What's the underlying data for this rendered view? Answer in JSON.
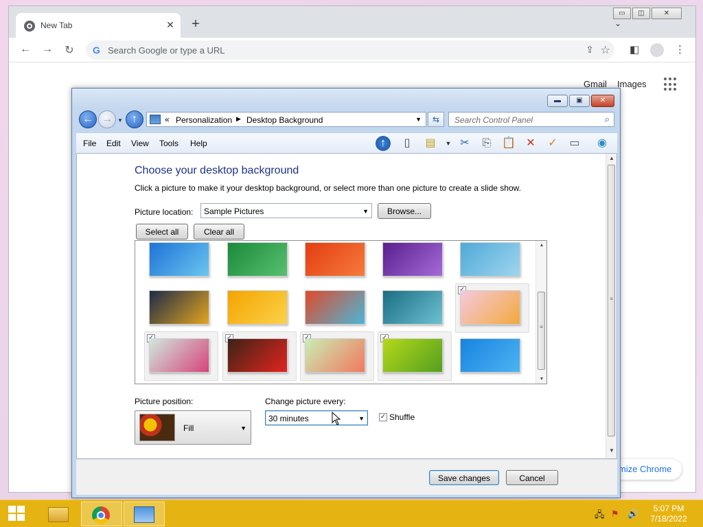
{
  "chrome": {
    "tab_title": "New Tab",
    "tab_close": "✕",
    "new_tab": "+",
    "tab_menu": "⌄",
    "omnibox_placeholder": "Search Google or type a URL",
    "google_g": "G",
    "gmail": "Gmail",
    "images": "Images",
    "customize_partial": "mize Chrome",
    "window_buttons": {
      "minimize": "▭",
      "maximize": "◫",
      "close": "✕"
    }
  },
  "control_panel": {
    "window_buttons": {
      "minimize": "▬",
      "maximize": "▣",
      "close": "✕"
    },
    "breadcrumb": {
      "prefix": "«",
      "item1": "Personalization",
      "separator": "▶",
      "item2": "Desktop Background"
    },
    "search_placeholder": "Search Control Panel",
    "menu": {
      "file": "File",
      "edit": "Edit",
      "view": "View",
      "tools": "Tools",
      "help": "Help"
    },
    "heading": "Choose your desktop background",
    "description": "Click a picture to make it your desktop background, or select more than one picture to create a slide show.",
    "picture_location_label": "Picture location:",
    "picture_location_value": "Sample Pictures",
    "browse_button": "Browse...",
    "select_all_button": "Select all",
    "clear_all_button": "Clear all",
    "thumbnails": [
      {
        "row": 1,
        "col": 1,
        "checked": false,
        "colors": [
          "#1e73d6",
          "#69c6f0"
        ]
      },
      {
        "row": 1,
        "col": 2,
        "checked": false,
        "colors": [
          "#1a8a3a",
          "#58c070"
        ]
      },
      {
        "row": 1,
        "col": 3,
        "checked": false,
        "colors": [
          "#e43d12",
          "#f57b3b"
        ]
      },
      {
        "row": 1,
        "col": 4,
        "checked": false,
        "colors": [
          "#5a1f8e",
          "#a66ad8"
        ]
      },
      {
        "row": 1,
        "col": 5,
        "checked": false,
        "colors": [
          "#4fa9d8",
          "#9fd5ee"
        ]
      },
      {
        "row": 2,
        "col": 1,
        "checked": false,
        "colors": [
          "#1d2b48",
          "#e3a51e"
        ]
      },
      {
        "row": 2,
        "col": 2,
        "checked": false,
        "colors": [
          "#f4a400",
          "#fbd24a"
        ]
      },
      {
        "row": 2,
        "col": 3,
        "checked": false,
        "colors": [
          "#e04a2a",
          "#4ab6d8"
        ]
      },
      {
        "row": 2,
        "col": 4,
        "checked": false,
        "colors": [
          "#1c6d84",
          "#6cc1d0"
        ]
      },
      {
        "row": 2,
        "col": 5,
        "checked": true,
        "colors": [
          "#f5c9dd",
          "#f3a93d"
        ]
      },
      {
        "row": 3,
        "col": 1,
        "checked": true,
        "colors": [
          "#cfe9de",
          "#d6447a"
        ]
      },
      {
        "row": 3,
        "col": 2,
        "checked": true,
        "colors": [
          "#3c2316",
          "#e3241f"
        ]
      },
      {
        "row": 3,
        "col": 3,
        "checked": true,
        "colors": [
          "#c8eeb4",
          "#f2785f"
        ]
      },
      {
        "row": 3,
        "col": 4,
        "checked": true,
        "colors": [
          "#b6d81a",
          "#53a01f"
        ]
      },
      {
        "row": 3,
        "col": 5,
        "checked": false,
        "colors": [
          "#1784e0",
          "#4cb3f2"
        ]
      }
    ],
    "picture_position_label": "Picture position:",
    "picture_position_value": "Fill",
    "change_picture_label": "Change picture every:",
    "change_picture_value": "30 minutes",
    "shuffle_label": "Shuffle",
    "shuffle_checked": true,
    "save_button": "Save changes",
    "cancel_button": "Cancel"
  },
  "taskbar": {
    "time": "5:07 PM",
    "date": "7/18/2022"
  }
}
